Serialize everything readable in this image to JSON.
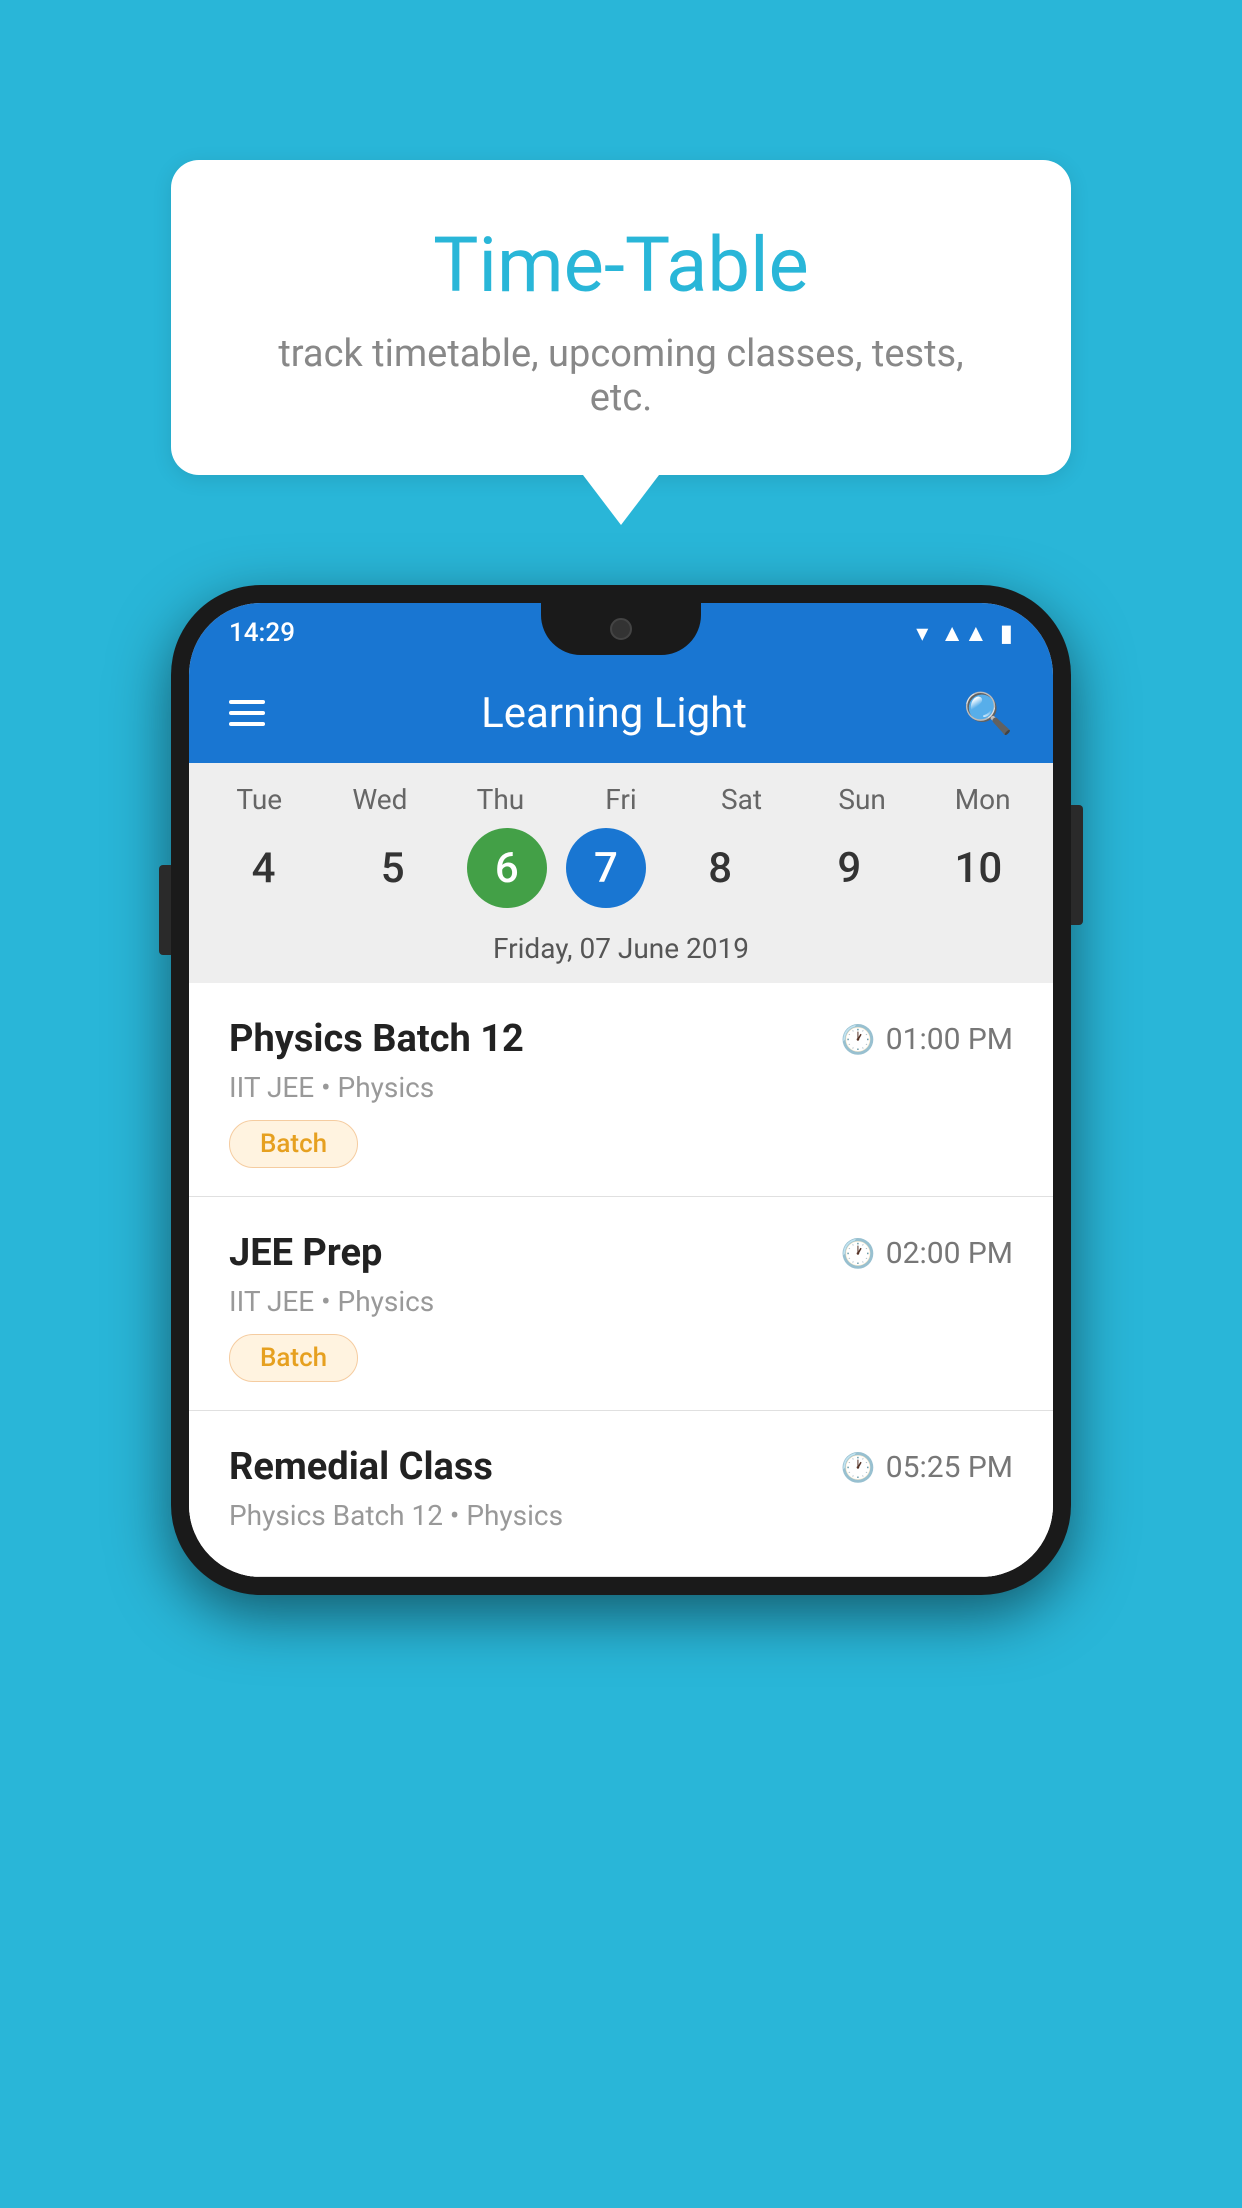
{
  "background_color": "#29B6D8",
  "speech_bubble": {
    "title": "Time-Table",
    "subtitle": "track timetable, upcoming classes, tests, etc."
  },
  "phone": {
    "status_bar": {
      "time": "14:29",
      "icons": [
        "wifi",
        "signal",
        "battery"
      ]
    },
    "app_bar": {
      "title": "Learning Light",
      "menu_icon": "hamburger",
      "search_icon": "search"
    },
    "calendar": {
      "days": [
        {
          "label": "Tue",
          "num": "4"
        },
        {
          "label": "Wed",
          "num": "5"
        },
        {
          "label": "Thu",
          "num": "6",
          "state": "today"
        },
        {
          "label": "Fri",
          "num": "7",
          "state": "selected"
        },
        {
          "label": "Sat",
          "num": "8"
        },
        {
          "label": "Sun",
          "num": "9"
        },
        {
          "label": "Mon",
          "num": "10"
        }
      ],
      "selected_date_label": "Friday, 07 June 2019"
    },
    "schedule": [
      {
        "name": "Physics Batch 12",
        "time": "01:00 PM",
        "sub": "IIT JEE • Physics",
        "badge": "Batch"
      },
      {
        "name": "JEE Prep",
        "time": "02:00 PM",
        "sub": "IIT JEE • Physics",
        "badge": "Batch"
      },
      {
        "name": "Remedial Class",
        "time": "05:25 PM",
        "sub": "Physics Batch 12 • Physics",
        "badge": null
      }
    ]
  }
}
